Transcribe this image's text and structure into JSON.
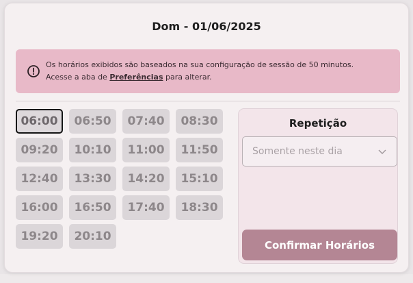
{
  "dialog": {
    "title": "Dom - 01/06/2025"
  },
  "alert": {
    "line1": "Os horários exibidos são baseados na sua configuração de sessão de 50 minutos.",
    "line2_prefix": "Acesse a aba de ",
    "line2_link": "Preferências",
    "line2_suffix": " para alterar.",
    "icon": "info-circle-icon"
  },
  "slots": [
    "06:00",
    "06:50",
    "07:40",
    "08:30",
    "09:20",
    "10:10",
    "11:00",
    "11:50",
    "12:40",
    "13:30",
    "14:20",
    "15:10",
    "16:00",
    "16:50",
    "17:40",
    "18:30",
    "19:20",
    "20:10"
  ],
  "selected_slot": "06:00",
  "repetition": {
    "title": "Repetição",
    "select_value": "Somente neste dia",
    "confirm_label": "Confirmar Horários"
  },
  "colors": {
    "alert_bg": "#e8b9c8",
    "confirm_bg": "#b48694",
    "panel_bg": "#f3e5ea"
  }
}
